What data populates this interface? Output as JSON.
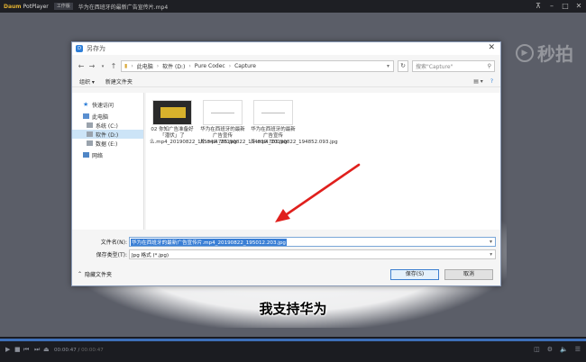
{
  "player": {
    "logo_brand": "Daum",
    "logo_name": "PotPlayer",
    "badge": "工作版",
    "file_title": "华为在西班牙的最新广告宣传片.mp4",
    "window_controls": [
      "pin-icon",
      "minimize-icon",
      "maximize-icon",
      "close-icon"
    ],
    "watermark": "秒拍",
    "subtitle": "我支持华为",
    "time_current": "00:00:47",
    "time_total": "00:00:47",
    "progress": 1.0
  },
  "dialog": {
    "title": "另存为",
    "address": [
      "此电脑",
      "软件 (D:)",
      "Pure Codec",
      "Capture"
    ],
    "search_placeholder": "搜索\"Capture\"",
    "toolbar": {
      "organize": "组织 ▾",
      "new_folder": "新建文件夹"
    },
    "sidebar": [
      {
        "label": "快速访问",
        "icon": "star-icon",
        "indent": 0,
        "selected": false
      },
      {
        "label": "此电脑",
        "icon": "computer-icon",
        "indent": 0,
        "selected": false
      },
      {
        "label": "系统 (C:)",
        "icon": "drive-icon",
        "indent": 1,
        "selected": false
      },
      {
        "label": "软件 (D:)",
        "icon": "drive-icon",
        "indent": 1,
        "selected": true
      },
      {
        "label": "数据 (E:)",
        "icon": "drive-icon",
        "indent": 1,
        "selected": false
      },
      {
        "label": "网络",
        "icon": "network-icon",
        "indent": 0,
        "selected": false
      }
    ],
    "files": [
      {
        "label": "02 你知广告准备好「潜伏」了么.mp4_20190822_185349.765.jpg",
        "thumb": "dark"
      },
      {
        "label": "华为在西班牙的最新广告宣传片.mp4_20190822_194839.703.jpg",
        "thumb": "light"
      },
      {
        "label": "华为在西班牙的最新广告宣传片.mp4_20190822_194852.093.jpg",
        "thumb": "light"
      }
    ],
    "filename_label": "文件名(N):",
    "filename_value": "华为在西班牙的最新广告宣传片.mp4_20190822_195012.203.jpg",
    "type_label": "保存类型(T):",
    "type_value": "Jpg 格式 (*.jpg)",
    "hide_folders": "隐藏文件夹",
    "save_button": "保存(S)",
    "cancel_button": "取消"
  }
}
